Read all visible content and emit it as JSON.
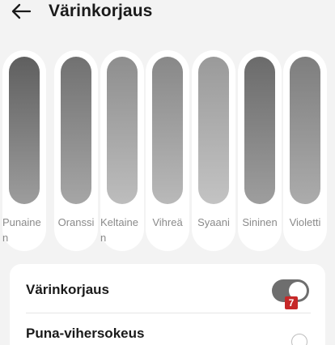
{
  "header": {
    "back_icon": "arrow-left-icon",
    "title": "Värinkorjaus"
  },
  "swatches": [
    {
      "label": "Punainen",
      "top": "#5f5f5f",
      "bottom": "#9d9d9d"
    },
    {
      "label": "Oranssi",
      "top": "#717171",
      "bottom": "#a6a6a6"
    },
    {
      "label": "Keltainen",
      "top": "#8e8e8e",
      "bottom": "#bdbdbd"
    },
    {
      "label": "Vihreä",
      "top": "#888888",
      "bottom": "#b9b9b9"
    },
    {
      "label": "Syaani",
      "top": "#9a9a9a",
      "bottom": "#c3c3c3"
    },
    {
      "label": "Sininen",
      "top": "#6b6b6b",
      "bottom": "#9e9e9e"
    },
    {
      "label": "Violetti",
      "top": "#7e7e7e",
      "bottom": "#acacac"
    }
  ],
  "settings": {
    "color_correction": {
      "label": "Värinkorjaus",
      "enabled": true
    },
    "badge": "7",
    "option_red_green": {
      "label": "Puna-vihersokeus",
      "selected": false
    }
  }
}
